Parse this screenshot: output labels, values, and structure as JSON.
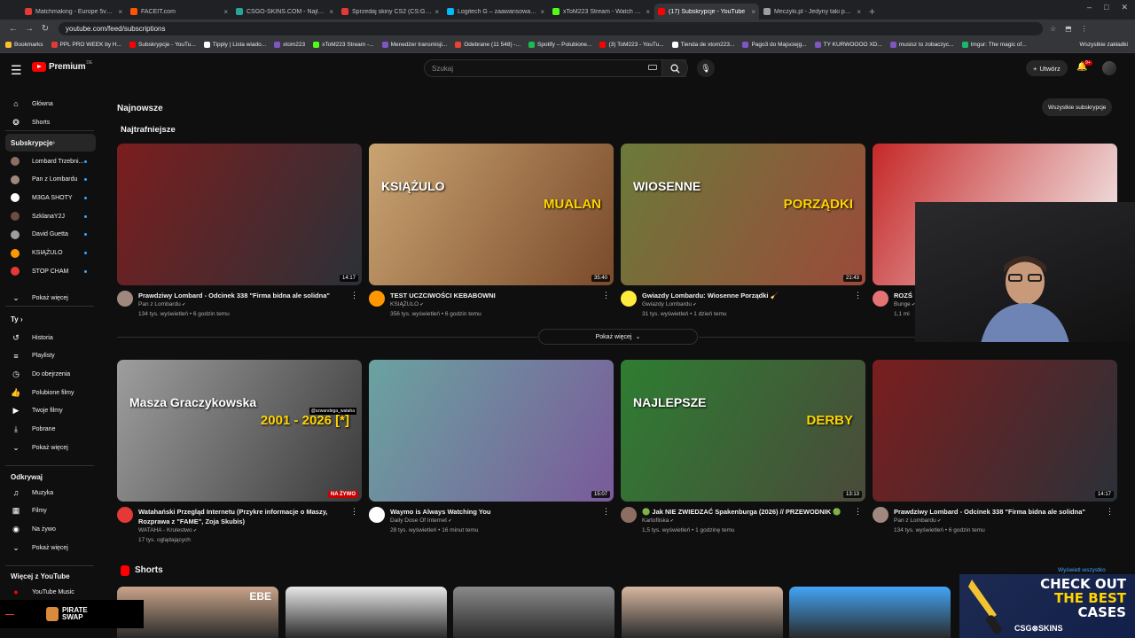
{
  "browser": {
    "tabs": [
      {
        "label": "Matchmaking - Europe 5v5 Qu",
        "color": "#e53935"
      },
      {
        "label": "FACEIT.com",
        "color": "#ff5500"
      },
      {
        "label": "CSGO-SKINS.COM - Najlepsz",
        "color": "#26a69a"
      },
      {
        "label": "Sprzedaj skiny CS2 (CS:GO) | N",
        "color": "#e53935"
      },
      {
        "label": "Logitech G – zaawansowany sp",
        "color": "#00b8fc"
      },
      {
        "label": "xToM223 Stream - Watch Live",
        "color": "#53fc18"
      },
      {
        "label": "(17) Subskrypcje - YouTube",
        "color": "#ff0000"
      },
      {
        "label": "Meczyki.pl - Jedyny taki portal",
        "color": "#9e9e9e"
      }
    ],
    "url": "youtube.com/feed/subscriptions",
    "bookmarks": [
      {
        "label": "Bookmarks",
        "color": "#fbc02d"
      },
      {
        "label": "PPL PRO WEEK by H...",
        "color": "#e53935"
      },
      {
        "label": "Subskrypcje - YouTu...",
        "color": "#ff0000"
      },
      {
        "label": "Tipply | Lista wiado...",
        "color": "#ffffff"
      },
      {
        "label": "xtom223",
        "color": "#7e57c2"
      },
      {
        "label": "xToM223 Stream -...",
        "color": "#53fc18"
      },
      {
        "label": "Menedżer transmisji...",
        "color": "#7e57c2"
      },
      {
        "label": "Odebrane (11 548) -...",
        "color": "#ea4335"
      },
      {
        "label": "Spotify – Polubione...",
        "color": "#1db954"
      },
      {
        "label": "(3) ToM223 - YouTu...",
        "color": "#ff0000"
      },
      {
        "label": "Tienda de xtom223...",
        "color": "#ffffff"
      },
      {
        "label": "Pago3 do Majsciejg...",
        "color": "#7e57c2"
      },
      {
        "label": "TY KURWOOOO XD...",
        "color": "#7e57c2"
      },
      {
        "label": "musisz to zobaczyc...",
        "color": "#7e57c2"
      },
      {
        "label": "Imgur: The magic of...",
        "color": "#1bb76e"
      }
    ],
    "all_bookmarks": "Wszystkie zakładki"
  },
  "header": {
    "logo_text": "Premium",
    "country_code": "DE",
    "search_placeholder": "Szukaj",
    "create_label": "Utwórz",
    "notification_badge": "9+"
  },
  "sidebar": {
    "top": [
      {
        "label": "Główna",
        "icon": "home-icon",
        "glyph": "⌂"
      },
      {
        "label": "Shorts",
        "icon": "shorts-icon",
        "glyph": "❂"
      }
    ],
    "subs_header": "Subskrypcje",
    "channels": [
      {
        "label": "Lombard Trzebni...",
        "color": "#8d6e63"
      },
      {
        "label": "Pan z Lombardu",
        "color": "#a1887f"
      },
      {
        "label": "M3GA SHOTY",
        "color": "#ffffff"
      },
      {
        "label": "SzklanaY2J",
        "color": "#6d4c41"
      },
      {
        "label": "David Guetta",
        "color": "#9e9e9e"
      },
      {
        "label": "KSIĄŻULO",
        "color": "#ff9800"
      },
      {
        "label": "STOP CHAM",
        "color": "#e53935"
      }
    ],
    "show_more": "Pokaż więcej",
    "you_header": "Ty",
    "you_items": [
      {
        "label": "Historia",
        "icon": "history-icon",
        "glyph": "↺"
      },
      {
        "label": "Playlisty",
        "icon": "playlists-icon",
        "glyph": "≡"
      },
      {
        "label": "Do obejrzenia",
        "icon": "watch-later-icon",
        "glyph": "◷"
      },
      {
        "label": "Polubione filmy",
        "icon": "liked-icon",
        "glyph": "👍"
      },
      {
        "label": "Twoje filmy",
        "icon": "your-videos-icon",
        "glyph": "▶"
      },
      {
        "label": "Pobrane",
        "icon": "downloads-icon",
        "glyph": "⤓"
      },
      {
        "label": "Pokaż więcej",
        "icon": "chevron-down-icon",
        "glyph": "⌄"
      }
    ],
    "explore_header": "Odkrywaj",
    "explore_items": [
      {
        "label": "Muzyka",
        "icon": "music-icon",
        "glyph": "♫"
      },
      {
        "label": "Filmy",
        "icon": "movies-icon",
        "glyph": "▦"
      },
      {
        "label": "Na żywo",
        "icon": "live-icon",
        "glyph": "◉"
      },
      {
        "label": "Pokaż więcej",
        "icon": "chevron-down-icon",
        "glyph": "⌄"
      }
    ],
    "more_header": "Więcej z YouTube",
    "more_items": [
      {
        "label": "YouTube Music",
        "icon": "youtube-music-icon",
        "glyph": "●"
      }
    ]
  },
  "main": {
    "title": "Najnowsze",
    "all_subs_button": "Wszystkie subskrypcje",
    "section_title": "Najtrafniejsze",
    "show_more": "Pokaż więcej",
    "row1": [
      {
        "title": "Prawdziwy Lombard - Odcinek 338 \"Firma bidna ale solidna\"",
        "channel": "Pan z Lombardu",
        "stats": "134 tys. wyświetleń • 6 godzin temu",
        "duration": "14:17",
        "thumb": "#7b1e1e",
        "thumb2": "#2b3138",
        "avatar": "#a1887f"
      },
      {
        "title": "TEST UCZCIWOŚCI KEBABOWNI",
        "channel": "KSIĄŻULO",
        "stats": "356 tys. wyświetleń • 6 godzin temu",
        "duration": "35:40",
        "thumb": "#c9a472",
        "thumb2": "#7a4a2a",
        "avatar": "#ff9800",
        "overlay1": "KSIĄŻULO",
        "overlay2": "MUALAN"
      },
      {
        "title": "Gwiazdy Lombardu: Wiosenne Porządki 🧹",
        "channel": "Gwiazdy Lombardu",
        "stats": "31 tys. wyświetleń • 1 dzień temu",
        "duration": "21:43",
        "thumb": "#6b7a3a",
        "thumb2": "#9b4a3a",
        "avatar": "#ffeb3b",
        "overlay1": "WIOSENNE",
        "overlay2": "PORZĄDKI"
      },
      {
        "title": "ROZŚ",
        "channel": "Bunge",
        "stats": "1,1 mi",
        "duration": "",
        "thumb": "#c62828",
        "thumb2": "#f5f5f5",
        "avatar": "#e57373"
      }
    ],
    "row2": [
      {
        "title": "Watahański Przegląd Internetu (Przykre informacje o Maszy, Rozprawa z \"FAME\", Zoja Skubis)",
        "channel": "WATAHA - Krulestwo",
        "stats": "17 tys. oglądających",
        "live": "NA ŻYWO",
        "thumb": "#9e9e9e",
        "thumb2": "#3a3a3a",
        "avatar": "#e53935",
        "overlay1": "Masza Graczykowska",
        "overlay2": "2001 - 2026 [*]",
        "overlay3": "@szwandega_wataha"
      },
      {
        "title": "Waymo is Always Watching You",
        "channel": "Daily Dose Of Internet",
        "stats": "28 tys. wyświetleń • 16 minut temu",
        "duration": "15:07",
        "thumb": "#6aa3a0",
        "thumb2": "#7a5a9a",
        "avatar": "#ffffff"
      },
      {
        "title": "🟢 Jak NIE ZWIEDZAĆ Spakenburga (2026) // PRZEWODNIK 🟢",
        "channel": "Kartofliska",
        "stats": "1,5 tys. wyświetleń • 1 godzinę temu",
        "duration": "13:13",
        "thumb": "#2e7d32",
        "thumb2": "#4a4a3a",
        "avatar": "#8d6e63",
        "overlay1": "NAJLEPSZE",
        "overlay2": "DERBY"
      },
      {
        "title": "Prawdziwy Lombard - Odcinek 338 \"Firma bidna ale solidna\"",
        "channel": "Pan z Lombardu",
        "stats": "134 tys. wyświetleń • 6 godzin temu",
        "duration": "14:17",
        "thumb": "#7b1e1e",
        "thumb2": "#2b3138",
        "avatar": "#a1887f"
      }
    ],
    "shorts_title": "Shorts",
    "shorts": [
      {
        "color": "#c9a48a",
        "label": "EBE"
      },
      {
        "color": "#e8e8e8",
        "label": ""
      },
      {
        "color": "#8a8a8a",
        "label": ""
      },
      {
        "color": "#d7b7a0",
        "label": ""
      },
      {
        "color": "#42a5f5",
        "label": ""
      }
    ]
  },
  "overlays": {
    "show_all": "Wyświetl wszystko",
    "promo_line1": "CHECK OUT",
    "promo_line2": "THE BEST",
    "promo_line3": "CASES",
    "promo_brand": "CSG⊗SKINS",
    "pirate_line1": "PIRATE",
    "pirate_line2": "SWAP"
  }
}
